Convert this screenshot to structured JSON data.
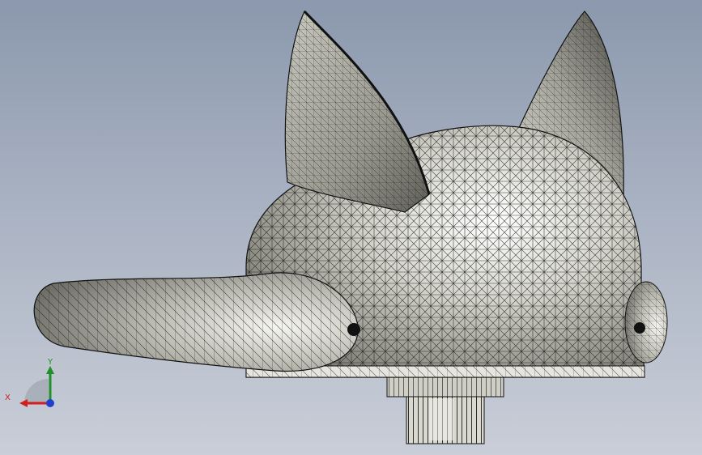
{
  "viewport": {
    "background_top": "#8b98ad",
    "background_bottom": "#c9ced8",
    "mesh_fill": "#e9e9e2",
    "mesh_shade": "#8f8f86",
    "mesh_line": "#1b1b1b"
  },
  "triad": {
    "x_label": "X",
    "y_label": "Y",
    "x_color": "#d11f1f",
    "y_color": "#1f8f2a",
    "z_color": "#1f3fd1"
  }
}
